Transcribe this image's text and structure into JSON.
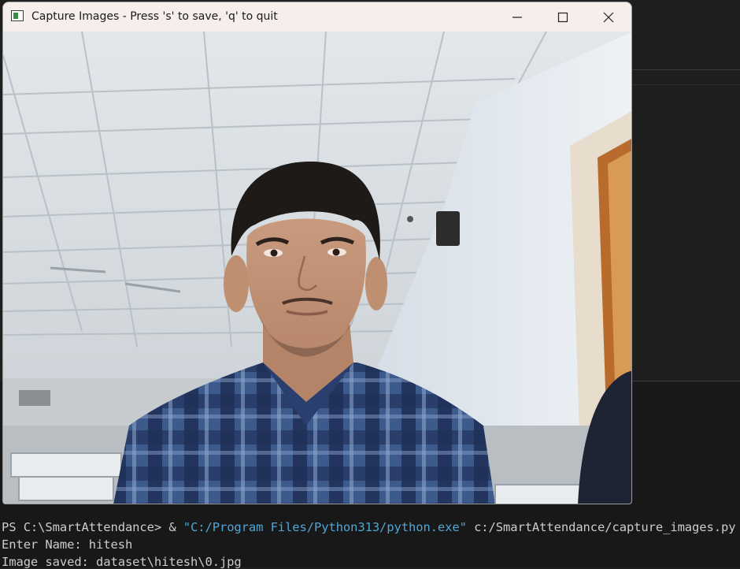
{
  "window": {
    "title": "Capture Images - Press 's' to save, 'q' to quit",
    "app_icon": "opencv-window-icon",
    "controls": {
      "minimize": "minimize-icon",
      "maximize": "maximize-icon",
      "close": "close-icon"
    }
  },
  "camera": {
    "description_icon": "webcam-feed"
  },
  "terminal": {
    "line1": {
      "prompt": "PS C:\\SmartAttendance> & ",
      "exe": "\"C:/Program Files/Python313/python.exe\"",
      "script": " c:/SmartAttendance/capture_images.py"
    },
    "line2": "Enter Name: hitesh",
    "line3": "Image saved: dataset\\hitesh\\0.jpg"
  },
  "colors": {
    "terminal_bg": "#181818",
    "terminal_text": "#cccccc",
    "terminal_string": "#4fa6d6",
    "titlebar_bg": "#f6eeea"
  }
}
